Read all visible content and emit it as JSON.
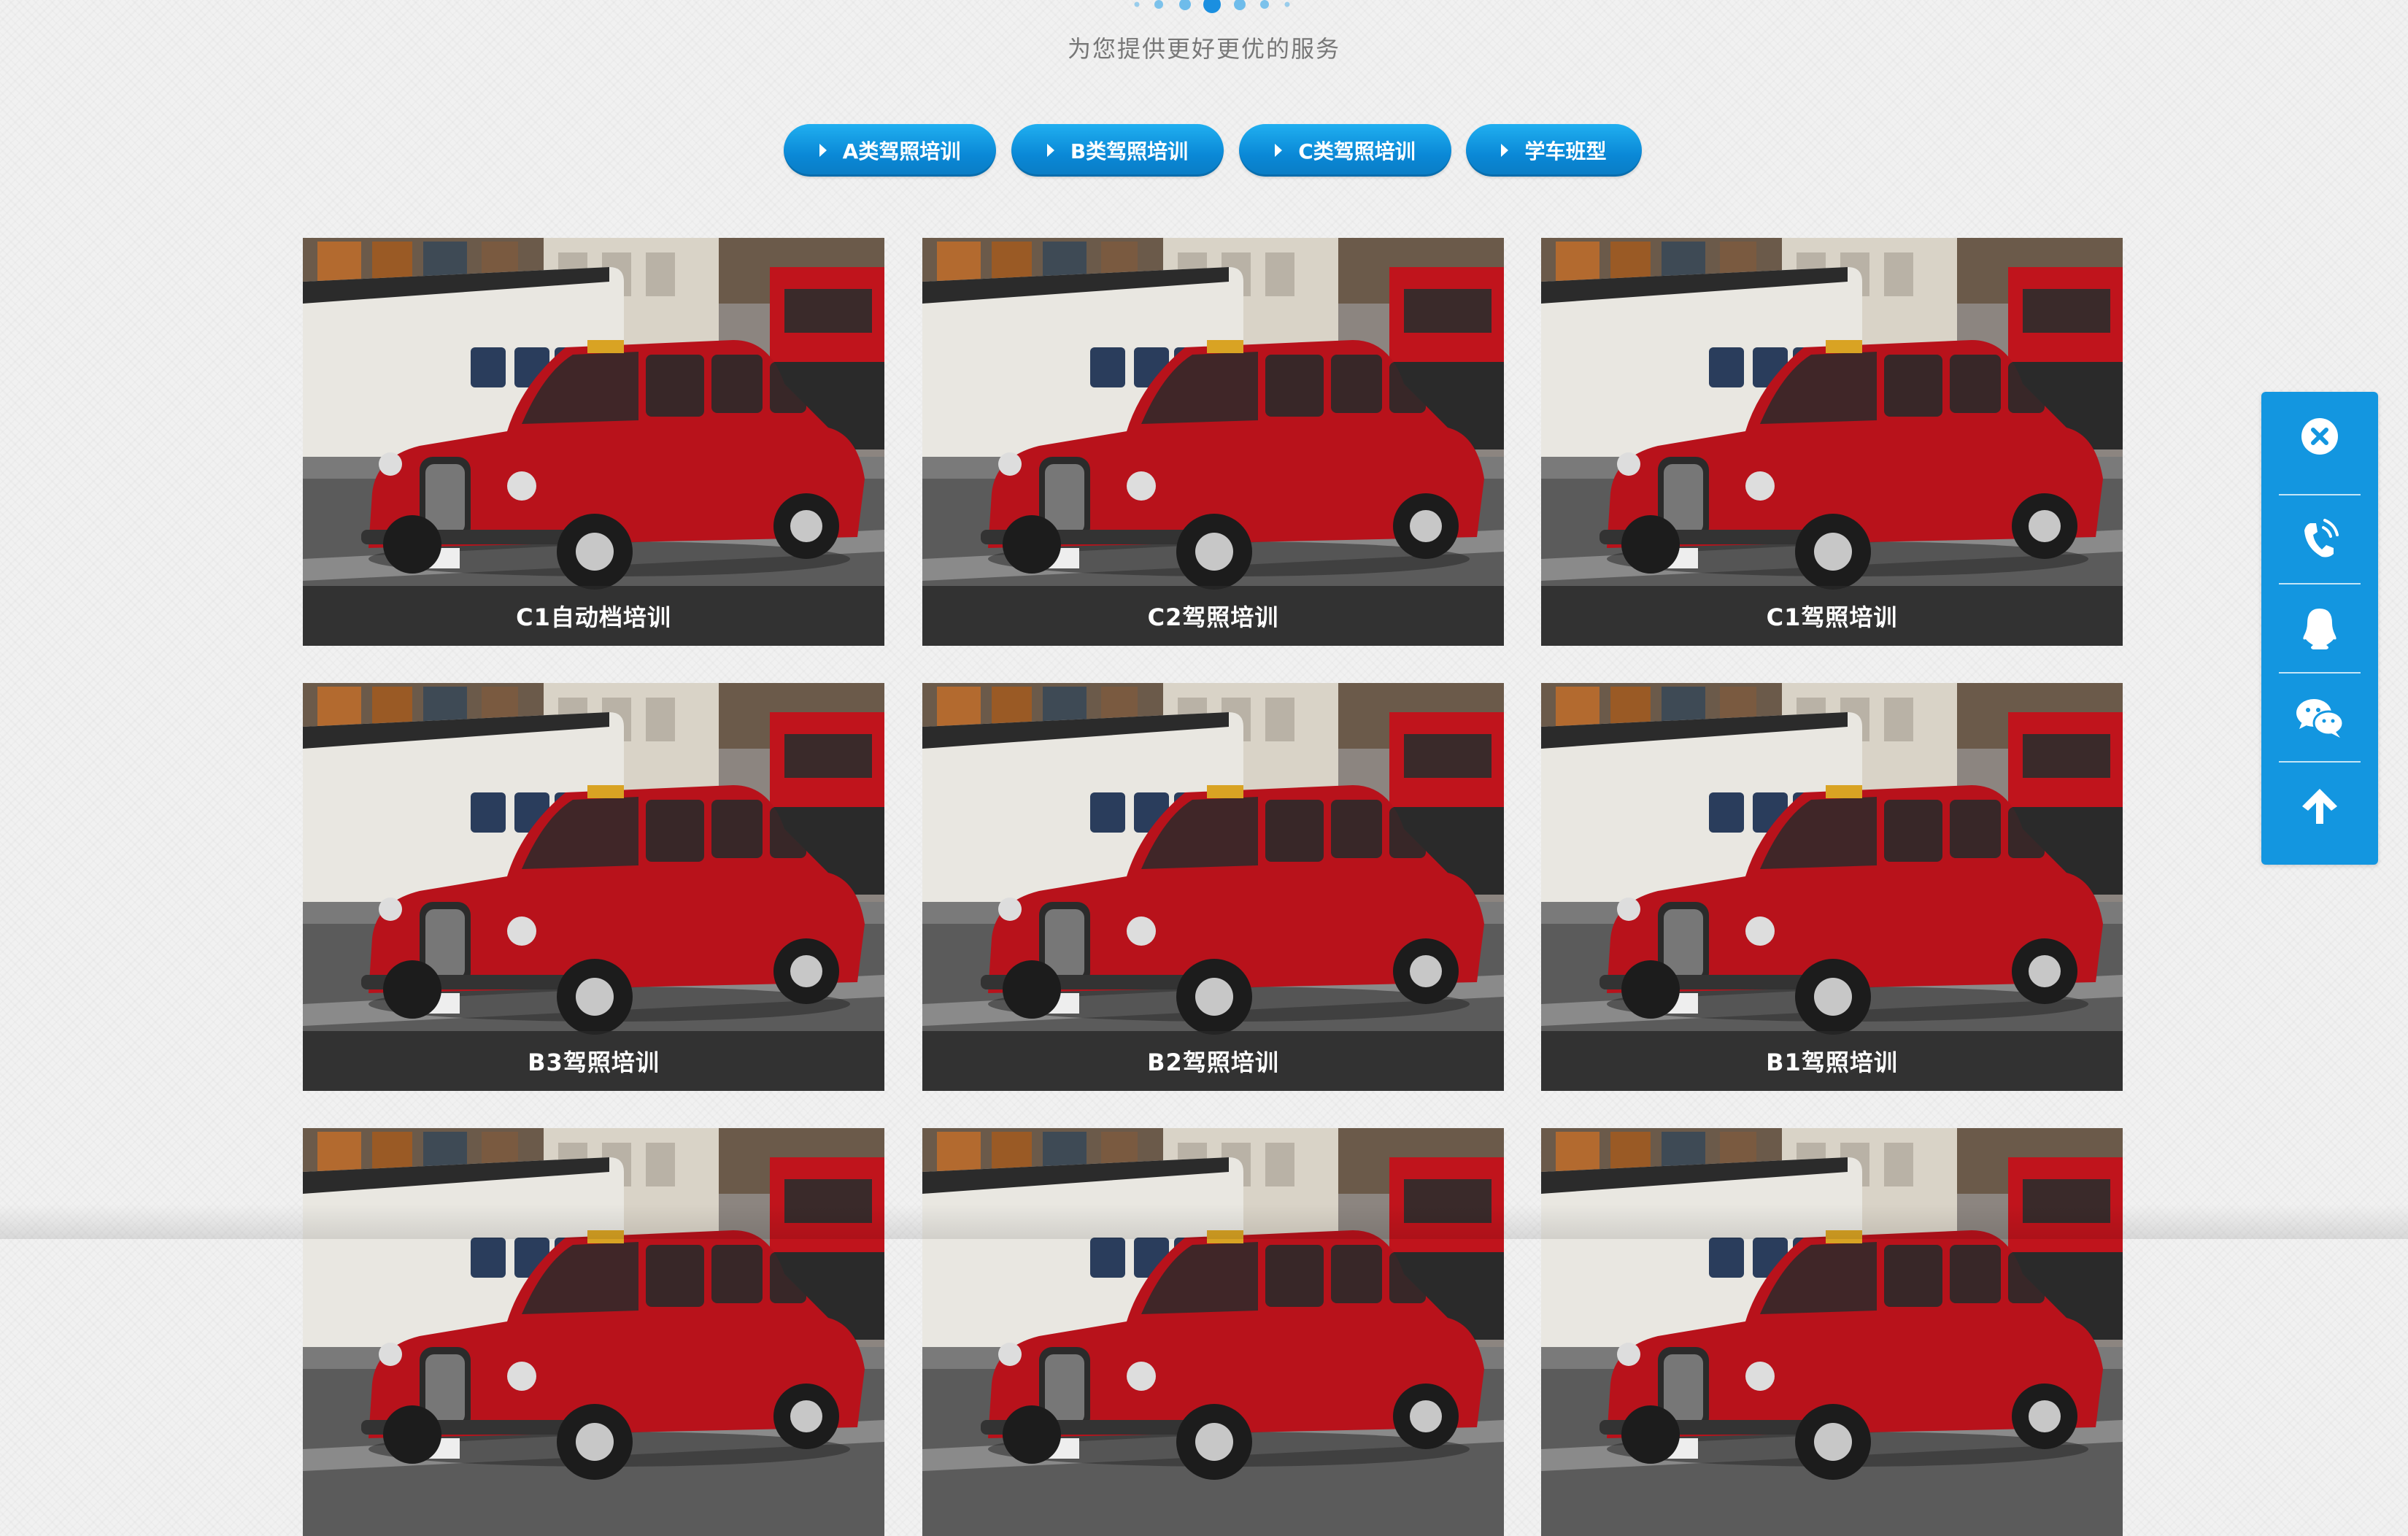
{
  "pager": {
    "dots": 7,
    "active_index": 3
  },
  "section": {
    "subtitle": "为您提供更好更优的服务"
  },
  "tabs": [
    {
      "label": "A类驾照培训"
    },
    {
      "label": "B类驾照培训"
    },
    {
      "label": "C类驾照培训"
    },
    {
      "label": "学车班型"
    }
  ],
  "cards": [
    {
      "caption": "C1自动档培训"
    },
    {
      "caption": "C2驾照培训"
    },
    {
      "caption": "C1驾照培训"
    },
    {
      "caption": "B3驾照培训"
    },
    {
      "caption": "B2驾照培训"
    },
    {
      "caption": "B1驾照培训"
    },
    {
      "caption": ""
    },
    {
      "caption": ""
    },
    {
      "caption": ""
    }
  ],
  "float_bar": {
    "items": [
      {
        "icon": "close-circle-icon"
      },
      {
        "icon": "phone-icon"
      },
      {
        "icon": "qq-icon"
      },
      {
        "icon": "wechat-icon"
      },
      {
        "icon": "arrow-up-icon"
      }
    ]
  },
  "colors": {
    "accent": "#1396e0",
    "tab_top": "#20aff0",
    "tab_bottom": "#0a7cc4",
    "car_red": "#b8121b"
  }
}
